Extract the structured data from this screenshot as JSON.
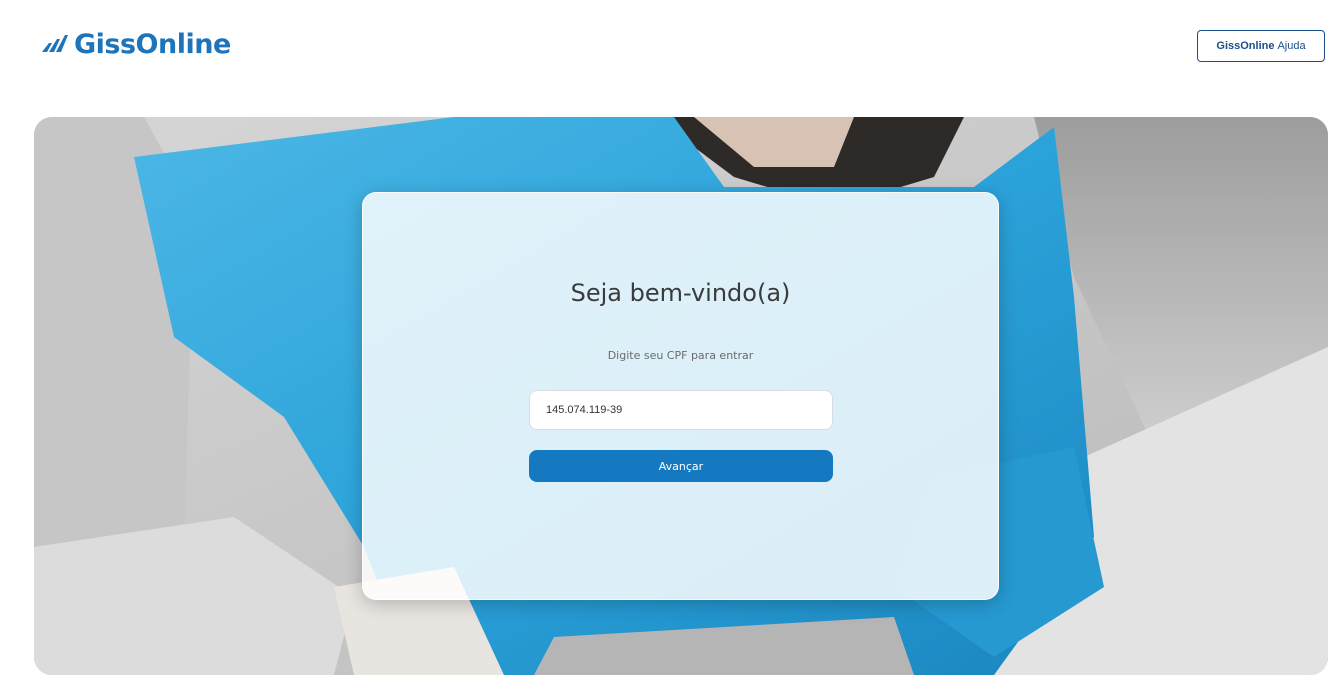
{
  "header": {
    "logo_text": "GissOnline",
    "help_button": {
      "bold": "GissOnline",
      "rest": "Ajuda"
    }
  },
  "login": {
    "title": "Seja bem-vindo(a)",
    "subtitle": "Digite seu CPF para entrar",
    "cpf_value": "145.074.119-39",
    "submit_label": "Avançar"
  },
  "colors": {
    "brand": "#1e74bb",
    "primary_button": "#1579c2",
    "hoodie": "#2ba3da"
  }
}
